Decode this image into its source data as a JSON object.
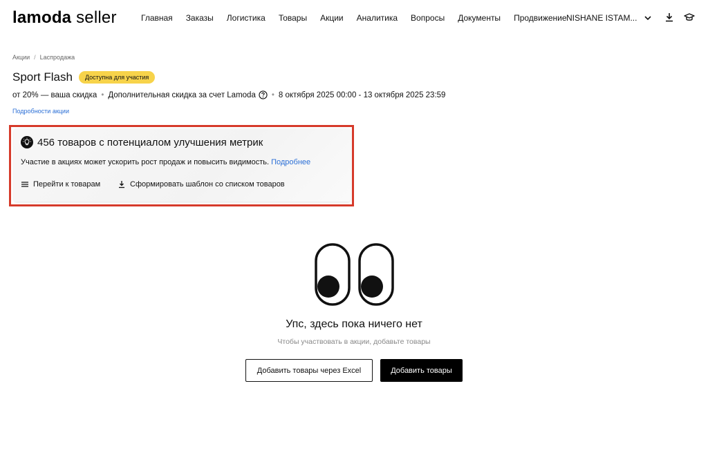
{
  "header": {
    "logo_brand": "lamoda",
    "logo_suffix": " seller",
    "nav": [
      {
        "label": "Главная"
      },
      {
        "label": "Заказы"
      },
      {
        "label": "Логистика"
      },
      {
        "label": "Товары"
      },
      {
        "label": "Акции"
      },
      {
        "label": "Аналитика"
      },
      {
        "label": "Вопросы"
      },
      {
        "label": "Документы"
      },
      {
        "label": "Продвижение"
      }
    ],
    "account_name": "NISHANE ISTAM...",
    "icons": [
      "download-icon",
      "graduation-cap-icon"
    ]
  },
  "breadcrumb": {
    "items": [
      "Акции",
      "Lаспродажа"
    ],
    "separator": "/"
  },
  "promo": {
    "title": "Sport Flash",
    "badge": "Доступна для участия",
    "badge_color": "#f7d34a",
    "discount": "от 20% — ваша скидка",
    "extra_discount": "Дополнительная скидка за счет Lamoda",
    "dates": "8 октября 2025 00:00 - 13 октября 2025 23:59",
    "details_link": "Подробности акции"
  },
  "card": {
    "icon": "lightbulb-icon",
    "title": "456 товаров с потенциалом улучшения метрик",
    "text": "Участие в акциях может ускорить рост продаж и повысить видимость.",
    "more_link": " Подробнее",
    "action_go": "Перейти к товарам",
    "action_template": "Сформировать шаблон со списком товаров",
    "highlight_color": "#d63a2a"
  },
  "empty_state": {
    "illustration": "eyes-illustration",
    "title": "Упс, здесь пока ничего нет",
    "subtitle": "Чтобы участвовать в акции, добавьте товары",
    "btn_excel": "Добавить товары через Excel",
    "btn_add": "Добавить товары"
  },
  "colors": {
    "link": "#2b6fd6",
    "primary_button": "#000000"
  }
}
